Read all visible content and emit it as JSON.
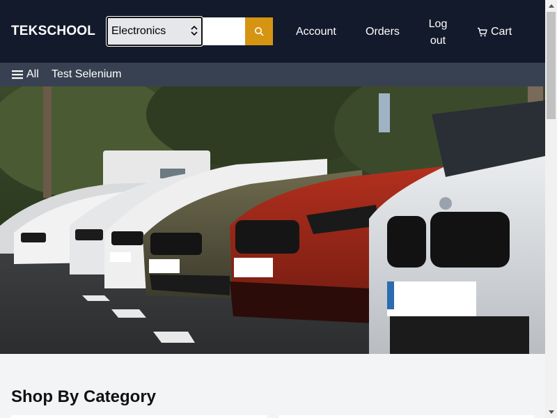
{
  "header": {
    "logo": "TEKSCHOOL",
    "category_select": {
      "selected": "Electronics"
    },
    "search": {
      "value": "",
      "placeholder": ""
    },
    "search_icon": "search-icon",
    "nav": {
      "account": "Account",
      "orders": "Orders",
      "logout_line1": "Log",
      "logout_line2": "out",
      "cart": "Cart"
    }
  },
  "subnav": {
    "all_label": "All",
    "menu_icon": "hamburger-icon",
    "link": "Test Selenium"
  },
  "hero": {
    "image": "row of parked sports cars"
  },
  "main": {
    "section_title": "Shop By Category"
  },
  "colors": {
    "header_bg": "#131a2b",
    "subnav_bg": "#374151",
    "search_button": "#d69413",
    "page_bg": "#f3f4f6"
  }
}
